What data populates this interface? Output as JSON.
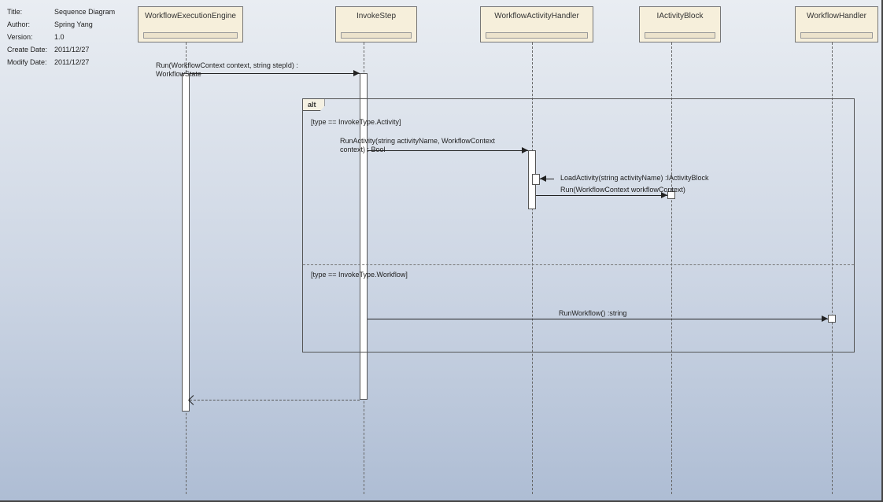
{
  "meta": {
    "labels": {
      "title": "Title:",
      "author": "Author:",
      "version": "Version:",
      "create_date": "Create Date:",
      "modify_date": "Modify Date:"
    },
    "values": {
      "title": "Sequence Diagram",
      "author": "Spring Yang",
      "version": "1.0",
      "create_date": "2011/12/27",
      "modify_date": "2011/12/27"
    }
  },
  "lifelines": {
    "l0": "WorkflowExecutionEngine",
    "l1": "InvokeStep",
    "l2": "WorkflowActivityHandler",
    "l3": "IActivityBlock",
    "l4": "WorkflowHandler"
  },
  "fragment": {
    "operator": "alt",
    "guard1": "[type == InvokeType.Activity]",
    "guard2": "[type == InvokeType.Workflow]"
  },
  "messages": {
    "m_run": "Run(WorkflowContext context, string stepId) : WorkflowState",
    "m_runActivity": "RunActivity(string activityName, WorkflowContext context) : Bool",
    "m_loadActivity": "LoadActivity(string activityName) :IActivityBlock",
    "m_runCtx": "Run(WorkflowContext workflowContext)",
    "m_runWorkflow": "RunWorkflow() :string"
  }
}
